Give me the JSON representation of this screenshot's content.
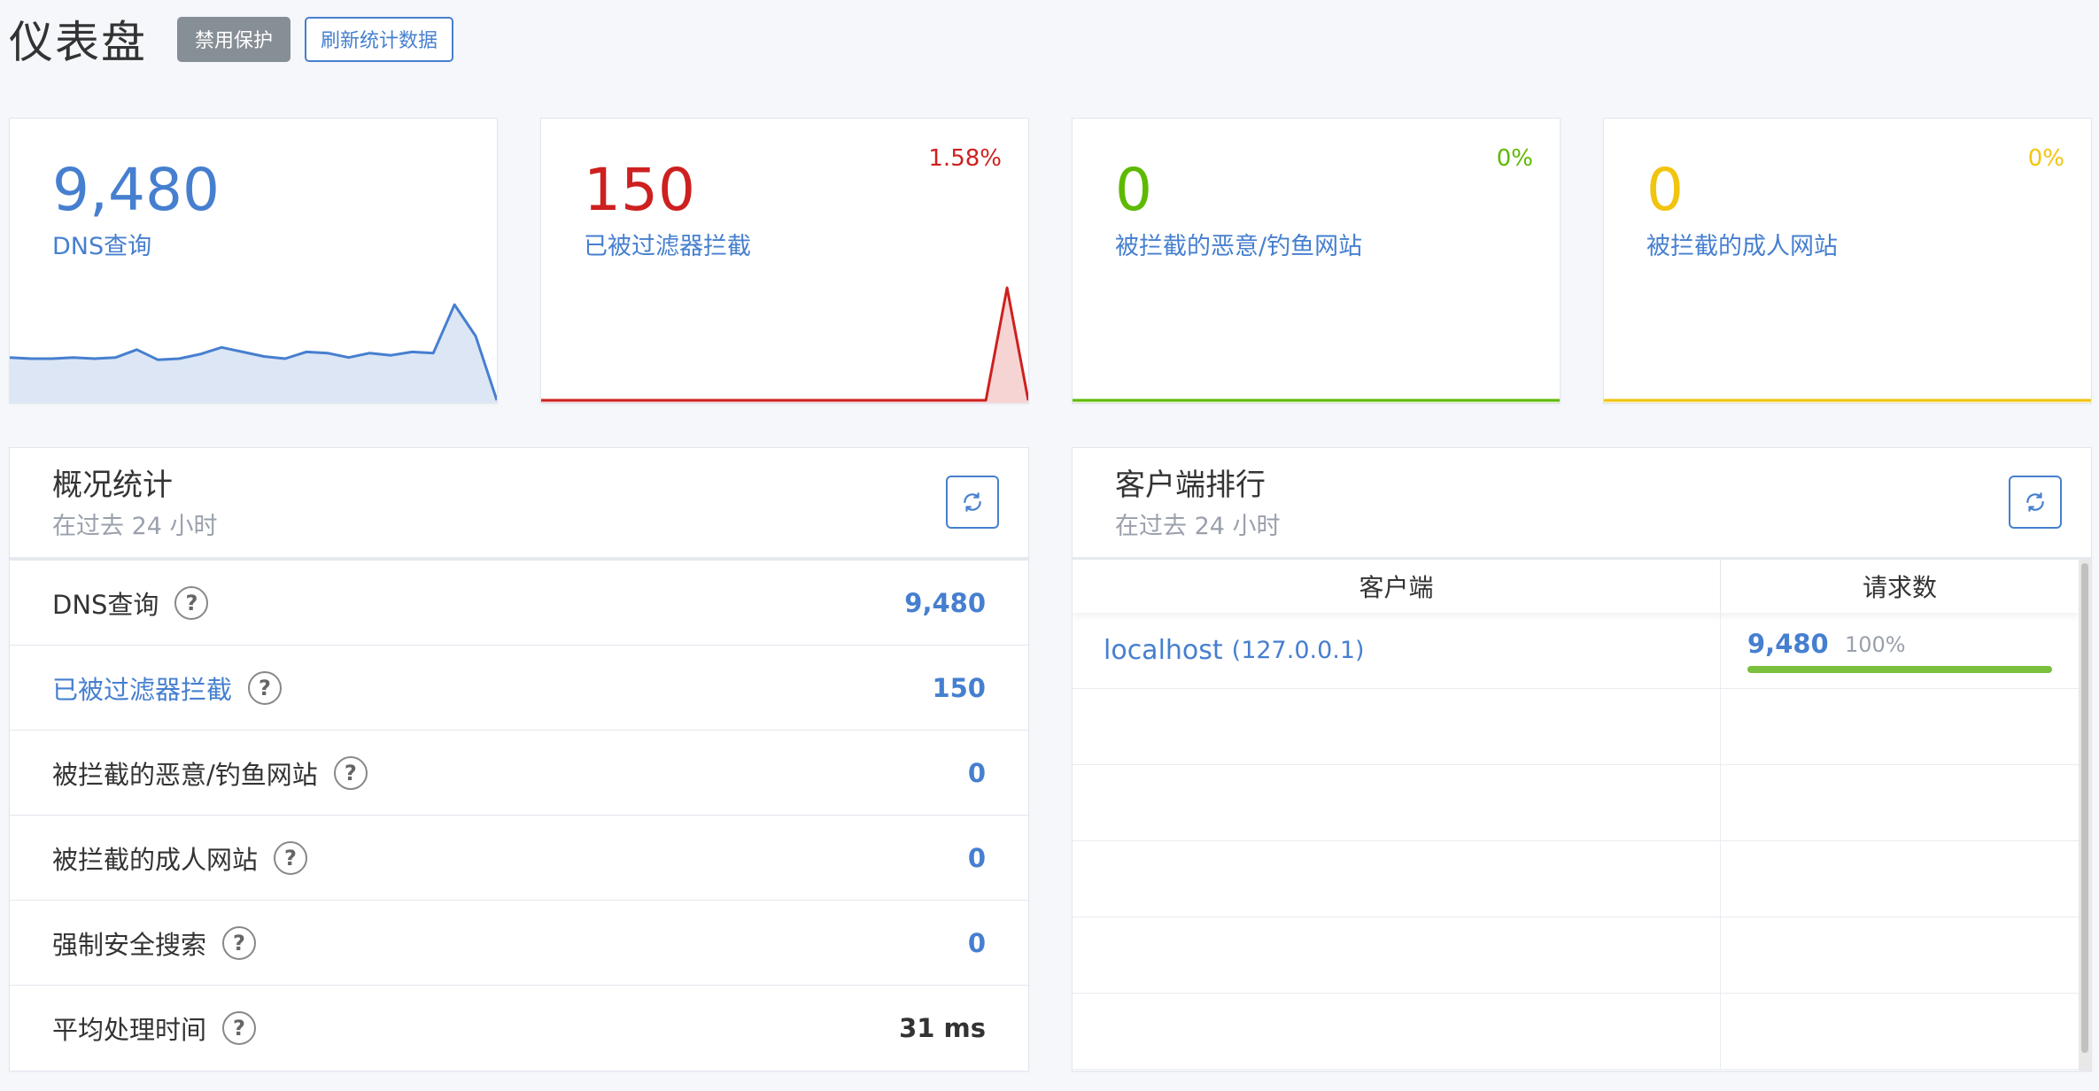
{
  "header": {
    "title": "仪表盘",
    "disable_label": "禁用保护",
    "refresh_label": "刷新统计数据"
  },
  "colors": {
    "primary": "#467fcf",
    "danger": "#cd201f",
    "success": "#5eba00",
    "warning": "#f1c40f"
  },
  "stat_cards": [
    {
      "value": "9,480",
      "label": "DNS查询",
      "percent": "",
      "color": "#467fcf"
    },
    {
      "value": "150",
      "label": "已被过滤器拦截",
      "percent": "1.58%",
      "color": "#cd201f"
    },
    {
      "value": "0",
      "label": "被拦截的恶意/钓鱼网站",
      "percent": "0%",
      "color": "#5eba00"
    },
    {
      "value": "0",
      "label": "被拦截的成人网站",
      "percent": "0%",
      "color": "#f1c40f"
    }
  ],
  "chart_data": [
    {
      "type": "area",
      "series": [
        {
          "values": [
            38,
            37,
            37,
            38,
            37,
            38,
            45,
            36,
            37,
            41,
            47,
            43,
            39,
            37,
            43,
            42,
            38,
            42,
            40,
            43,
            42,
            85,
            57,
            0
          ]
        }
      ]
    },
    {
      "type": "area",
      "series": [
        {
          "values": [
            0,
            0,
            0,
            0,
            0,
            0,
            0,
            0,
            0,
            0,
            0,
            0,
            0,
            0,
            0,
            0,
            0,
            0,
            0,
            0,
            0,
            0,
            100,
            0
          ]
        }
      ]
    },
    {
      "type": "area",
      "series": [
        {
          "values": [
            0,
            0,
            0,
            0,
            0,
            0,
            0,
            0,
            0,
            0,
            0,
            0,
            0,
            0,
            0,
            0,
            0,
            0,
            0,
            0,
            0,
            0,
            0,
            0
          ]
        }
      ]
    },
    {
      "type": "area",
      "series": [
        {
          "values": [
            0,
            0,
            0,
            0,
            0,
            0,
            0,
            0,
            0,
            0,
            0,
            0,
            0,
            0,
            0,
            0,
            0,
            0,
            0,
            0,
            0,
            0,
            0,
            0
          ]
        }
      ]
    }
  ],
  "overview": {
    "title": "概况统计",
    "subtitle": "在过去 24 小时",
    "rows": [
      {
        "label": "DNS查询",
        "value": "9,480"
      },
      {
        "label": "已被过滤器拦截",
        "value": "150"
      },
      {
        "label": "被拦截的恶意/钓鱼网站",
        "value": "0"
      },
      {
        "label": "被拦截的成人网站",
        "value": "0"
      },
      {
        "label": "强制安全搜索",
        "value": "0"
      },
      {
        "label": "平均处理时间",
        "value": "31 ms"
      }
    ]
  },
  "clients": {
    "title": "客户端排行",
    "subtitle": "在过去 24 小时",
    "col_client": "客户端",
    "col_requests": "请求数",
    "rows": [
      {
        "name": "localhost",
        "ip": "(127.0.0.1)",
        "count": "9,480",
        "percent": "100%",
        "fraction": 1.0
      }
    ]
  },
  "help_glyph": "?"
}
